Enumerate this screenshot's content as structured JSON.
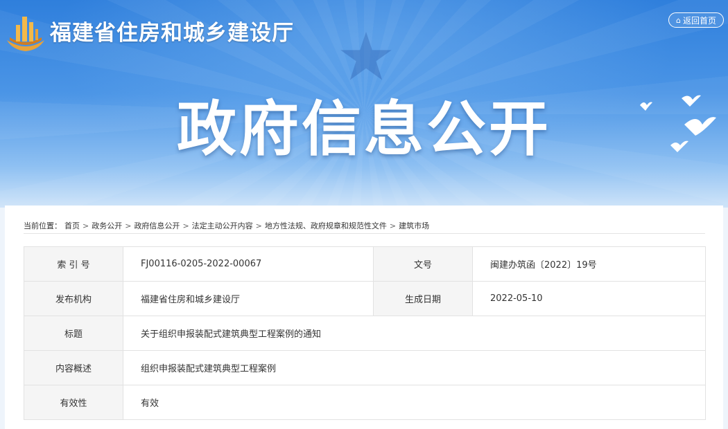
{
  "header": {
    "site_title": "福建省住房和城乡建设厅",
    "home_button": "返回首页",
    "banner_title": "政府信息公开"
  },
  "breadcrumb": {
    "prefix": "当前位置：",
    "items": [
      "首页",
      "政务公开",
      "政府信息公开",
      "法定主动公开内容",
      "地方性法规、政府规章和规范性文件",
      "建筑市场"
    ],
    "separator": ">"
  },
  "meta": {
    "index_label": "索 引 号",
    "index_value": "FJ00116-0205-2022-00067",
    "docno_label": "文号",
    "docno_value": "闽建办筑函〔2022〕19号",
    "publisher_label": "发布机构",
    "publisher_value": "福建省住房和城乡建设厅",
    "date_label": "生成日期",
    "date_value": "2022-05-10",
    "title_label": "标题",
    "title_value": "关于组织申报装配式建筑典型工程案例的通知",
    "summary_label": "内容概述",
    "summary_value": "组织申报装配式建筑典型工程案例",
    "validity_label": "有效性",
    "validity_value": "有效"
  },
  "icons": {
    "logo": "building-logo-icon",
    "home": "home-icon",
    "star": "star-icon",
    "birds": "doves-icon"
  },
  "colors": {
    "banner_top": "#2f7fdc",
    "banner_bottom": "#cfe4f9",
    "label_bg": "#f5f5f5",
    "border": "#e2e2e2"
  }
}
